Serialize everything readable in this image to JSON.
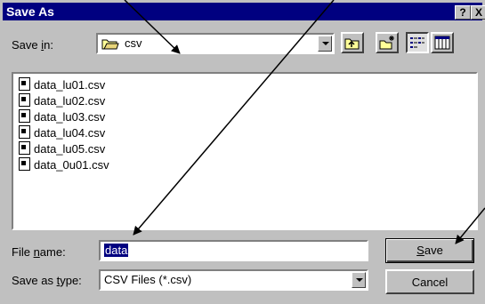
{
  "dialog": {
    "title": "Save As",
    "help_btn": "?",
    "close_btn": "X"
  },
  "save_in": {
    "label_prefix": "Save ",
    "label_accel": "i",
    "label_suffix": "n:",
    "folder_name": "csv"
  },
  "files": [
    "data_lu01.csv",
    "data_lu02.csv",
    "data_lu03.csv",
    "data_lu04.csv",
    "data_lu05.csv",
    "data_0u01.csv"
  ],
  "file_name": {
    "label_prefix": "File ",
    "label_accel": "n",
    "label_suffix": "ame:",
    "value": "data"
  },
  "save_type": {
    "label_prefix": "Save as ",
    "label_accel": "t",
    "label_suffix": "ype:",
    "value": "CSV Files (*.csv)"
  },
  "buttons": {
    "save_accel": "S",
    "save_rest": "ave",
    "cancel": "Cancel"
  }
}
